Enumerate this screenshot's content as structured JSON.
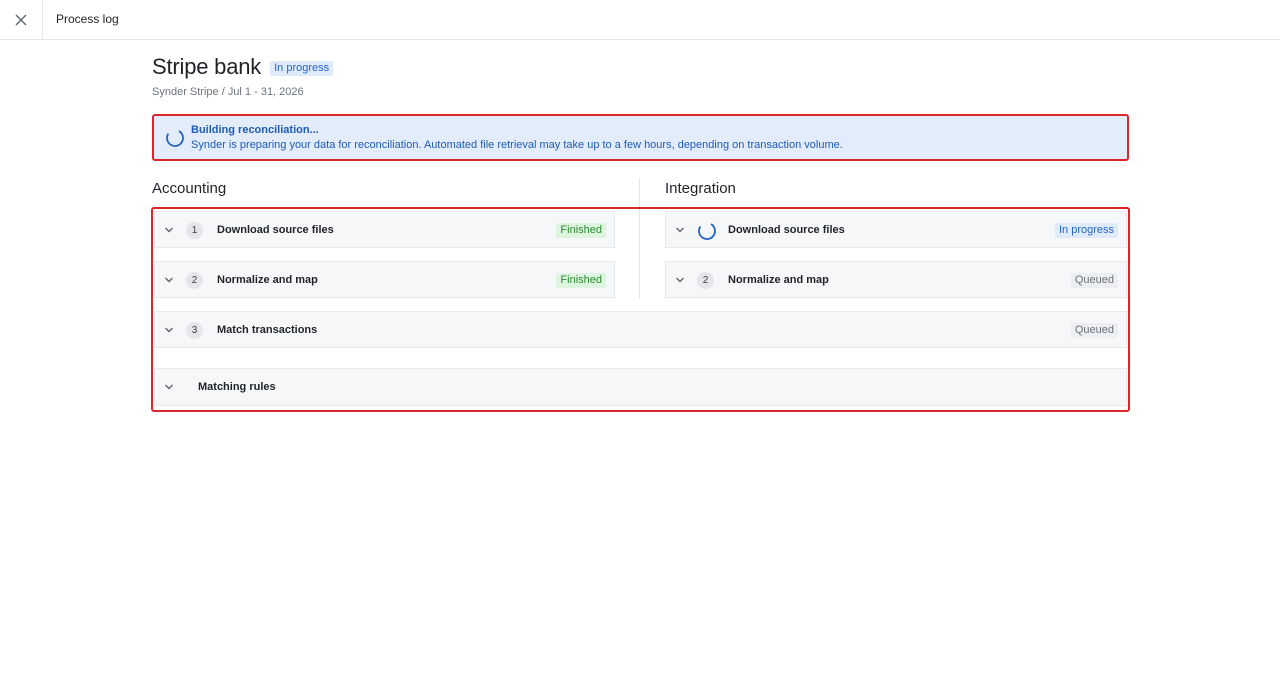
{
  "topbar": {
    "title": "Process log"
  },
  "header": {
    "title": "Stripe bank",
    "status": "In progress",
    "subtitle": "Synder Stripe / Jul 1 - 31, 2026"
  },
  "banner": {
    "title": "Building reconciliation...",
    "text": "Synder is preparing your data for reconciliation. Automated file retrieval may take up to a few hours, depending on transaction volume."
  },
  "accounting": {
    "heading": "Accounting",
    "steps": [
      {
        "num": "1",
        "label": "Download source files",
        "status": "Finished"
      },
      {
        "num": "2",
        "label": "Normalize and map",
        "status": "Finished"
      }
    ]
  },
  "integration": {
    "heading": "Integration",
    "steps": [
      {
        "label": "Download source files",
        "status": "In progress"
      },
      {
        "num": "2",
        "label": "Normalize and map",
        "status": "Queued"
      }
    ]
  },
  "match": {
    "num": "3",
    "label": "Match transactions",
    "status": "Queued"
  },
  "rules": {
    "label": "Matching rules"
  },
  "colors": {
    "accent": "#2564c7",
    "success": "#2f8a35",
    "neutral": "#6d737c",
    "highlight": "#d9262b"
  }
}
